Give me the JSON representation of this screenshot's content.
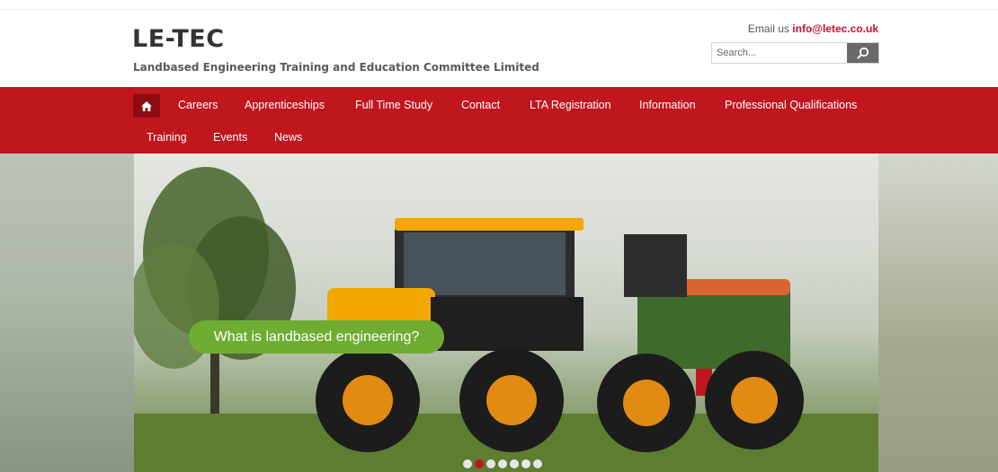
{
  "header": {
    "title": "LE-TEC",
    "subtitle": "Landbased Engineering Training and Education Committee Limited",
    "email_prefix": "Email us ",
    "email": "info@letec.co.uk"
  },
  "search": {
    "placeholder": "Search..."
  },
  "nav": {
    "home_icon": "home-icon",
    "items": [
      {
        "label": "Careers"
      },
      {
        "label": "Apprenticeships"
      },
      {
        "label": "Full Time Study"
      },
      {
        "label": "Contact"
      },
      {
        "label": "LTA Registration"
      },
      {
        "label": "Information"
      },
      {
        "label": "Professional Qualifications"
      },
      {
        "label": "Training"
      },
      {
        "label": "Events"
      },
      {
        "label": "News"
      }
    ]
  },
  "hero": {
    "cta_label": "What is landbased engineering?",
    "slide_count": 7,
    "active_slide": 2
  },
  "colors": {
    "brand_red": "#c0161d",
    "cta_green": "#6fac32",
    "email_red": "#c8102e"
  }
}
